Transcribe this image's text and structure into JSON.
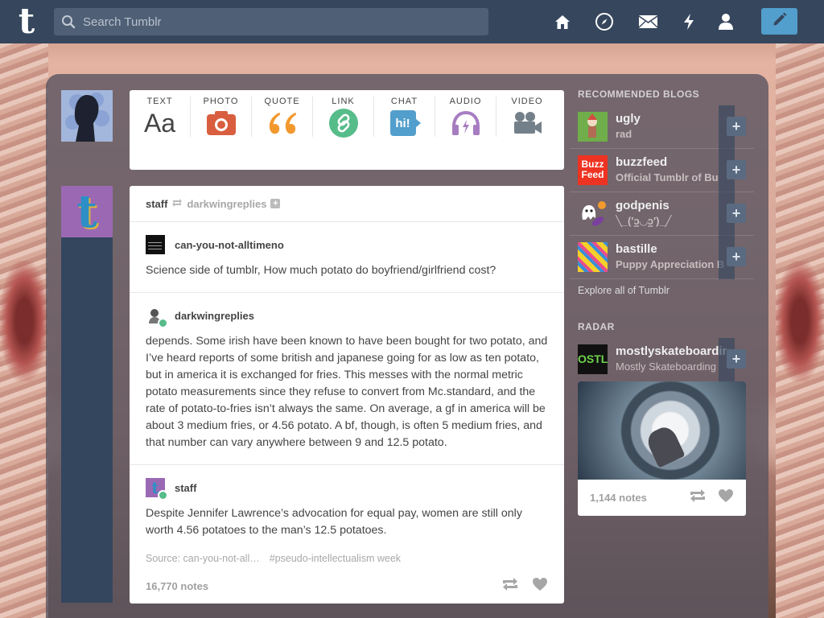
{
  "header": {
    "logo": "t",
    "search_placeholder": "Search Tumblr",
    "nav": [
      "home-icon",
      "explore-compass-icon",
      "inbox-envelope-icon",
      "activity-lightning-icon",
      "account-person-icon"
    ],
    "compose_icon": "pencil-icon"
  },
  "post_types": [
    {
      "label": "TEXT",
      "icon": "text-icon",
      "color": "#444444",
      "glyph": "Aa"
    },
    {
      "label": "PHOTO",
      "icon": "camera-icon",
      "color": "#d95e40"
    },
    {
      "label": "QUOTE",
      "icon": "quote-icon",
      "color": "#f2992e",
      "glyph": "66"
    },
    {
      "label": "LINK",
      "icon": "link-icon",
      "color": "#56bc8a"
    },
    {
      "label": "CHAT",
      "icon": "chat-icon",
      "color": "#529ecc",
      "glyph": "hi!"
    },
    {
      "label": "AUDIO",
      "icon": "headphones-icon",
      "color": "#a77dc2"
    },
    {
      "label": "VIDEO",
      "icon": "video-camera-icon",
      "color": "#748089"
    }
  ],
  "post": {
    "author": "staff",
    "reblogged_from": "darkwingreplies",
    "reblogs": [
      {
        "user": "can-you-not-alltimeno",
        "text": "Science side of tumblr, How much potato do boyfriend/girlfriend cost?"
      },
      {
        "user": "darkwingreplies",
        "text": "depends. Some irish have been known to have been bought for two potato, and I’ve heard reports of some british and japanese going for as low as ten potato, but in america it is exchanged for fries. This messes with the normal metric potato measurements since they refuse to convert from Mc.standard, and the rate of potato-to-fries isn’t always the same. On average, a gf in america will be about 3 medium fries, or 4.56 potato. A bf, though, is often 5 medium fries, and that number can vary anywhere between 9 and 12.5 potato."
      },
      {
        "user": "staff",
        "text": "Despite Jennifer Lawrence’s advocation for equal pay, women are still only worth 4.56 potatoes to the man’s 12.5 potatoes."
      }
    ],
    "source": "Source: can-you-not-all…",
    "tag": "#pseudo-intellectualism week",
    "notes": "16,770 notes"
  },
  "sidebar": {
    "recommended_title": "RECOMMENDED BLOGS",
    "blogs": [
      {
        "name": "ugly",
        "subtitle": "rad"
      },
      {
        "name": "buzzfeed",
        "subtitle": "Official Tumblr of Bu"
      },
      {
        "name": "godpenis",
        "subtitle": "╲_(′ɔ͇◡ɔ͇′)_╱"
      },
      {
        "name": "bastille",
        "subtitle": "Puppy Appreciation B"
      }
    ],
    "explore": "Explore all of Tumblr",
    "radar_title": "RADAR",
    "radar": {
      "name": "mostlyskateboarding",
      "subtitle": "Mostly Skateboarding",
      "notes": "1,144 notes"
    }
  },
  "colors": {
    "header": "#36465d",
    "compose": "#529ecc",
    "rail": "#34465e"
  }
}
